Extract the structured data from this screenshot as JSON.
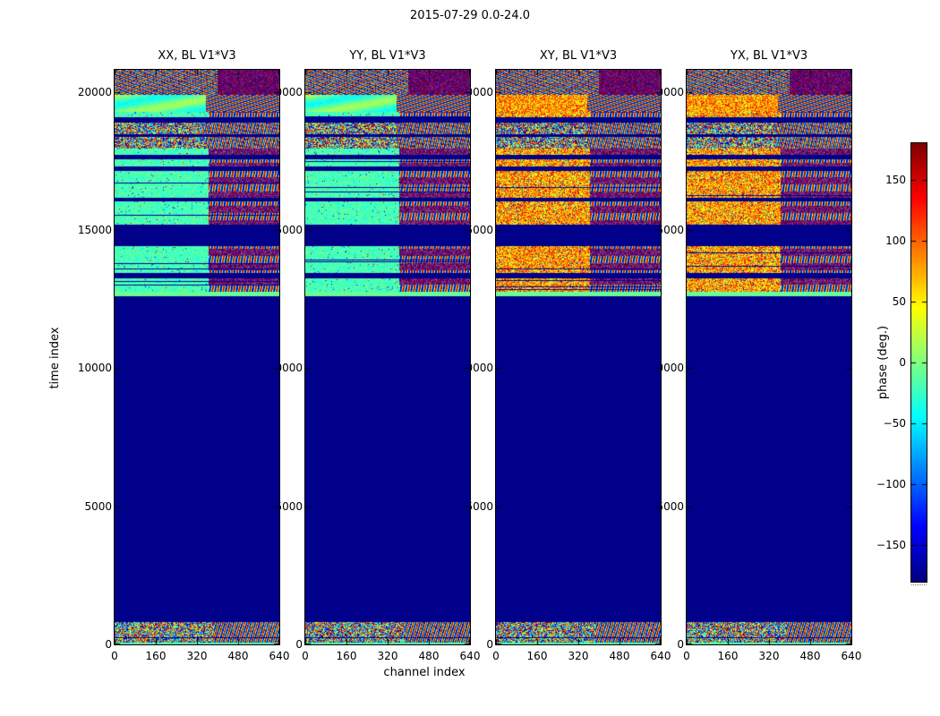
{
  "chart_data": {
    "type": "heatmap",
    "title": "2015-07-29 0.0-24.0",
    "xlabel": "channel index",
    "ylabel": "time index",
    "x_range": [
      0,
      640
    ],
    "y_range": [
      0,
      20810
    ],
    "x_ticks": [
      0,
      160,
      320,
      480,
      640
    ],
    "x_tick_labels": [
      "0",
      "160",
      "320",
      "480",
      "640"
    ],
    "y_ticks": [
      0,
      5000,
      10000,
      15000,
      20000
    ],
    "y_tick_labels": [
      "0",
      "5000",
      "10000",
      "15000",
      "20000"
    ],
    "colorbar": {
      "label": "phase (deg.)",
      "ticks": [
        150,
        100,
        50,
        0,
        -50,
        -100,
        -150
      ],
      "tick_labels": [
        "150",
        "100",
        "50",
        "0",
        "−50",
        "−100",
        "−150"
      ],
      "range": [
        -180,
        180
      ],
      "colormap": "jet"
    },
    "panels": [
      {
        "id": "XX",
        "title": "XX, BL V1*V3",
        "palette": "cool"
      },
      {
        "id": "YY",
        "title": "YY, BL V1*V3",
        "palette": "cool"
      },
      {
        "id": "XY",
        "title": "XY, BL V1*V3",
        "palette": "warm"
      },
      {
        "id": "YX",
        "title": "YX, BL V1*V3",
        "palette": "warm"
      }
    ],
    "bands": [
      {
        "t0": 20810,
        "t1": 19900,
        "kind": "fringes"
      },
      {
        "t0": 19900,
        "t1": 19285,
        "kind": "smooth"
      },
      {
        "t0": 19285,
        "t1": 19090,
        "kind": "band"
      },
      {
        "t0": 19090,
        "t1": 18900,
        "kind": "dark"
      },
      {
        "t0": 18900,
        "t1": 18475,
        "kind": "noise"
      },
      {
        "t0": 18475,
        "t1": 18380,
        "kind": "dark"
      },
      {
        "t0": 18380,
        "t1": 17955,
        "kind": "noise"
      },
      {
        "t0": 17955,
        "t1": 17730,
        "kind": "band"
      },
      {
        "t0": 17730,
        "t1": 17570,
        "kind": "dark"
      },
      {
        "t0": 17570,
        "t1": 17310,
        "kind": "band"
      },
      {
        "t0": 17310,
        "t1": 17145,
        "kind": "dark"
      },
      {
        "t0": 17145,
        "t1": 16920,
        "kind": "band"
      },
      {
        "t0": 16920,
        "t1": 16175,
        "kind": "band"
      },
      {
        "t0": 16175,
        "t1": 16045,
        "kind": "dark"
      },
      {
        "t0": 16045,
        "t1": 15200,
        "kind": "band"
      },
      {
        "t0": 15200,
        "t1": 14425,
        "kind": "dark"
      },
      {
        "t0": 14425,
        "t1": 13450,
        "kind": "band"
      },
      {
        "t0": 13450,
        "t1": 13255,
        "kind": "dark"
      },
      {
        "t0": 13255,
        "t1": 12770,
        "kind": "band"
      },
      {
        "t0": 12770,
        "t1": 12610,
        "kind": "green"
      },
      {
        "t0": 12610,
        "t1": 810,
        "kind": "dark"
      },
      {
        "t0": 810,
        "t1": 0,
        "kind": "bottom"
      }
    ],
    "colors": {
      "background": "#ffffff",
      "axes": "#000000",
      "blank_navy": "#000080"
    }
  }
}
